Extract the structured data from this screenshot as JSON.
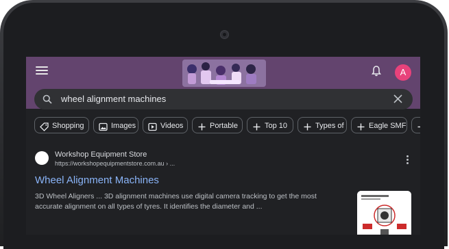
{
  "header": {
    "avatar_letter": "A",
    "accent_color": "#63446e"
  },
  "search": {
    "query": "wheel alignment machines"
  },
  "chips": [
    {
      "label": "Shopping",
      "icon": "tag-icon"
    },
    {
      "label": "Images",
      "icon": "image-icon"
    },
    {
      "label": "Videos",
      "icon": "play-icon"
    },
    {
      "label": "Portable",
      "icon": "plus-icon"
    },
    {
      "label": "Top 10",
      "icon": "plus-icon"
    },
    {
      "label": "Types of",
      "icon": "plus-icon"
    },
    {
      "label": "Eagle SMF",
      "icon": "plus-icon"
    }
  ],
  "result": {
    "site_name": "Workshop Equipment Store",
    "site_url": "https://workshopequipmentstore.com.au › ...",
    "title": "Wheel Alignment Machines",
    "snippet": "3D Wheel Aligners ... 3D alignment machines use digital camera tracking to get the most accurate alignment on all types of tyres. It identifies the diameter and ..."
  }
}
